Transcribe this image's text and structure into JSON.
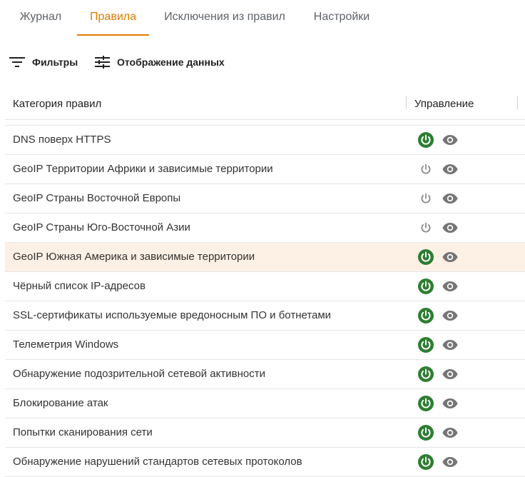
{
  "tabs": [
    {
      "label": "Журнал",
      "active": false
    },
    {
      "label": "Правила",
      "active": true
    },
    {
      "label": "Исключения из правил",
      "active": false
    },
    {
      "label": "Настройки",
      "active": false
    }
  ],
  "toolbar": {
    "filters_label": "Фильтры",
    "filters_icon": "filter-icon",
    "display_label": "Отображение данных",
    "display_icon": "tune-icon"
  },
  "table": {
    "headers": {
      "category": "Категория правил",
      "management": "Управление"
    },
    "rows": [
      {
        "name": "DNS поверх HTTPS",
        "enabled": true,
        "highlighted": false
      },
      {
        "name": "GeoIP Территории Африки и зависимые территории",
        "enabled": false,
        "highlighted": false
      },
      {
        "name": "GeoIP Страны Восточной Европы",
        "enabled": false,
        "highlighted": false
      },
      {
        "name": "GeoIP Страны Юго-Восточной Азии",
        "enabled": false,
        "highlighted": false
      },
      {
        "name": "GeoIP Южная Америка и зависимые территории",
        "enabled": true,
        "highlighted": true
      },
      {
        "name": "Чёрный список IP-адресов",
        "enabled": true,
        "highlighted": false
      },
      {
        "name": "SSL-сертификаты используемые вредоносным ПО и ботнетами",
        "enabled": true,
        "highlighted": false
      },
      {
        "name": "Телеметрия Windows",
        "enabled": true,
        "highlighted": false
      },
      {
        "name": "Обнаружение подозрительной сетевой активности",
        "enabled": true,
        "highlighted": false
      },
      {
        "name": "Блокирование атак",
        "enabled": true,
        "highlighted": false
      },
      {
        "name": "Попытки сканирования сети",
        "enabled": true,
        "highlighted": false
      },
      {
        "name": "Обнаружение нарушений стандартов сетевых протоколов",
        "enabled": true,
        "highlighted": false
      }
    ]
  },
  "colors": {
    "accent": "#e07b00",
    "power_on": "#2e7d32",
    "power_off": "#8a8a8a",
    "eye": "#757575",
    "row_highlight": "#fdf0e4"
  }
}
